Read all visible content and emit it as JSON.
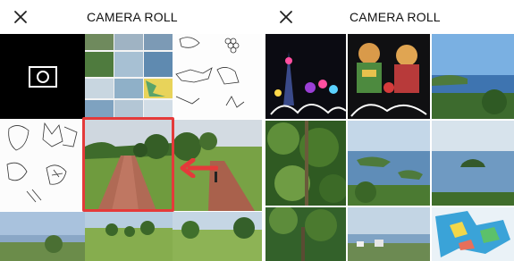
{
  "left_panel": {
    "title": "CAMERA ROLL",
    "close_icon": "close-icon",
    "camera_icon": "camera-icon",
    "tiles": [
      "camera-capture",
      "photo-collage-landscape",
      "sketch-botanical",
      "sketch-animals",
      "photo-park-path",
      "photo-park-path-person",
      "photo-bay-view",
      "photo-park-lawn",
      "photo-park-trees"
    ],
    "highlight_color": "#e43a3a",
    "arrow_direction": "pointing-left"
  },
  "right_panel": {
    "title": "CAMERA ROLL",
    "close_icon": "close-icon",
    "tiles": [
      "photo-night-tower-lights",
      "photo-illuminated-figures",
      "photo-coastal-view",
      "photo-forest-foliage",
      "photo-island-bay",
      "photo-sea-island",
      "photo-tree-canopy",
      "photo-harbor-town",
      "photo-map-sign"
    ]
  },
  "colors": {
    "accent": "#e43a3a",
    "background": "#ffffff",
    "text": "#111111"
  }
}
